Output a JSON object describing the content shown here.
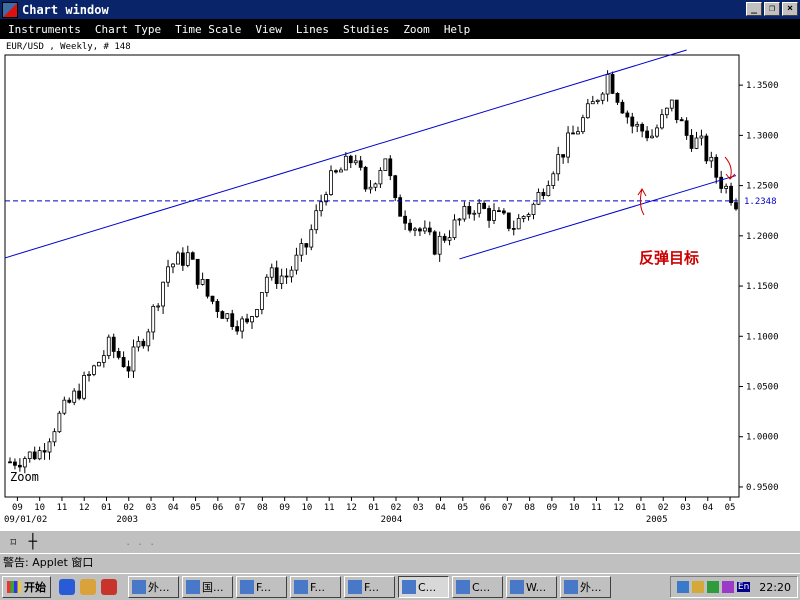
{
  "window": {
    "title": "Chart window",
    "buttons": [
      "_",
      "❐",
      "×"
    ]
  },
  "menu": [
    "Instruments",
    "Chart Type",
    "Time Scale",
    "View",
    "Lines",
    "Studies",
    "Zoom",
    "Help"
  ],
  "chart_header": "EUR/USD , Weekly, # 148",
  "chart_data": {
    "type": "candlestick",
    "instrument": "EUR/USD",
    "timeframe": "Weekly",
    "ylim": [
      0.94,
      1.38
    ],
    "yticks": [
      "1.3500",
      "1.3000",
      "1.2500",
      "1.2000",
      "1.1500",
      "1.1000",
      "1.0500",
      "1.0000",
      "0.9500"
    ],
    "xticks": [
      "09",
      "10",
      "11",
      "12",
      "01",
      "02",
      "03",
      "04",
      "05",
      "06",
      "07",
      "08",
      "09",
      "10",
      "11",
      "12",
      "01",
      "02",
      "03",
      "04",
      "05",
      "06",
      "07",
      "08",
      "09",
      "10",
      "11",
      "12",
      "01",
      "02",
      "03",
      "04",
      "05"
    ],
    "xyears": {
      "start": "09/01/02",
      "y2003": "2003",
      "y2004": "2004",
      "y2005": "2005"
    },
    "price_line_label": "1.2348",
    "annotation": "反弹目标",
    "zoom_label": "Zoom",
    "anchors": [
      [
        0,
        0.975
      ],
      [
        6,
        0.985
      ],
      [
        10,
        1.02
      ],
      [
        16,
        1.06
      ],
      [
        20,
        1.09
      ],
      [
        24,
        1.07
      ],
      [
        28,
        1.11
      ],
      [
        32,
        1.17
      ],
      [
        36,
        1.18
      ],
      [
        40,
        1.14
      ],
      [
        44,
        1.12
      ],
      [
        48,
        1.11
      ],
      [
        52,
        1.16
      ],
      [
        56,
        1.16
      ],
      [
        60,
        1.19
      ],
      [
        64,
        1.25
      ],
      [
        68,
        1.27
      ],
      [
        70,
        1.28
      ],
      [
        72,
        1.24
      ],
      [
        74,
        1.26
      ],
      [
        76,
        1.28
      ],
      [
        78,
        1.23
      ],
      [
        82,
        1.21
      ],
      [
        86,
        1.19
      ],
      [
        90,
        1.21
      ],
      [
        94,
        1.23
      ],
      [
        98,
        1.22
      ],
      [
        102,
        1.21
      ],
      [
        106,
        1.23
      ],
      [
        110,
        1.27
      ],
      [
        114,
        1.3
      ],
      [
        118,
        1.33
      ],
      [
        121,
        1.36
      ],
      [
        123,
        1.34
      ],
      [
        126,
        1.31
      ],
      [
        130,
        1.3
      ],
      [
        134,
        1.33
      ],
      [
        137,
        1.3
      ],
      [
        140,
        1.29
      ],
      [
        143,
        1.26
      ],
      [
        147,
        1.235
      ]
    ],
    "channel_upper": [
      [
        0,
        1.178
      ],
      [
        137,
        1.385
      ]
    ],
    "channel_lower": [
      [
        91,
        1.177
      ],
      [
        147,
        1.26
      ]
    ],
    "horizontal_level": 1.2348
  },
  "lowerbar": {
    "tool1": "⌑",
    "tool2": "┼",
    "dots": ". . ."
  },
  "status": "警告: Applet 窗口",
  "taskbar": {
    "start": "开始",
    "tasks": [
      "外...",
      "国...",
      "F...",
      "F...",
      "F...",
      "C...",
      "C...",
      "W...",
      "外..."
    ],
    "active_task": 5,
    "tray_en": "En",
    "clock": "22:20"
  }
}
